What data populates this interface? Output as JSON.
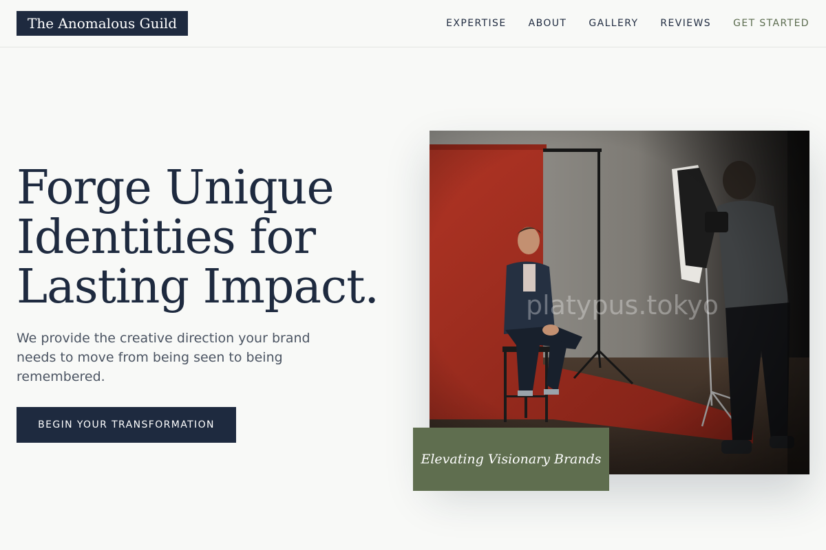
{
  "brand": {
    "name": "The Anomalous Guild",
    "primary_color": "#1e2a3f",
    "accent_color": "#5f6e4f",
    "background_color": "#f8f9f7"
  },
  "nav": {
    "items": [
      {
        "label": "EXPERTISE"
      },
      {
        "label": "ABOUT"
      },
      {
        "label": "GALLERY"
      },
      {
        "label": "REVIEWS"
      },
      {
        "label": "GET STARTED"
      }
    ]
  },
  "hero": {
    "headline_lines": [
      "Forge Unique",
      "Identities for",
      "Lasting Impact."
    ],
    "subtext": "We provide the creative direction your brand needs to move from being seen to being remembered.",
    "cta_label": "BEGIN YOUR TRANSFORMATION",
    "image_watermark": "platypus.tokyo",
    "caption": "Elevating Visionary Brands"
  }
}
